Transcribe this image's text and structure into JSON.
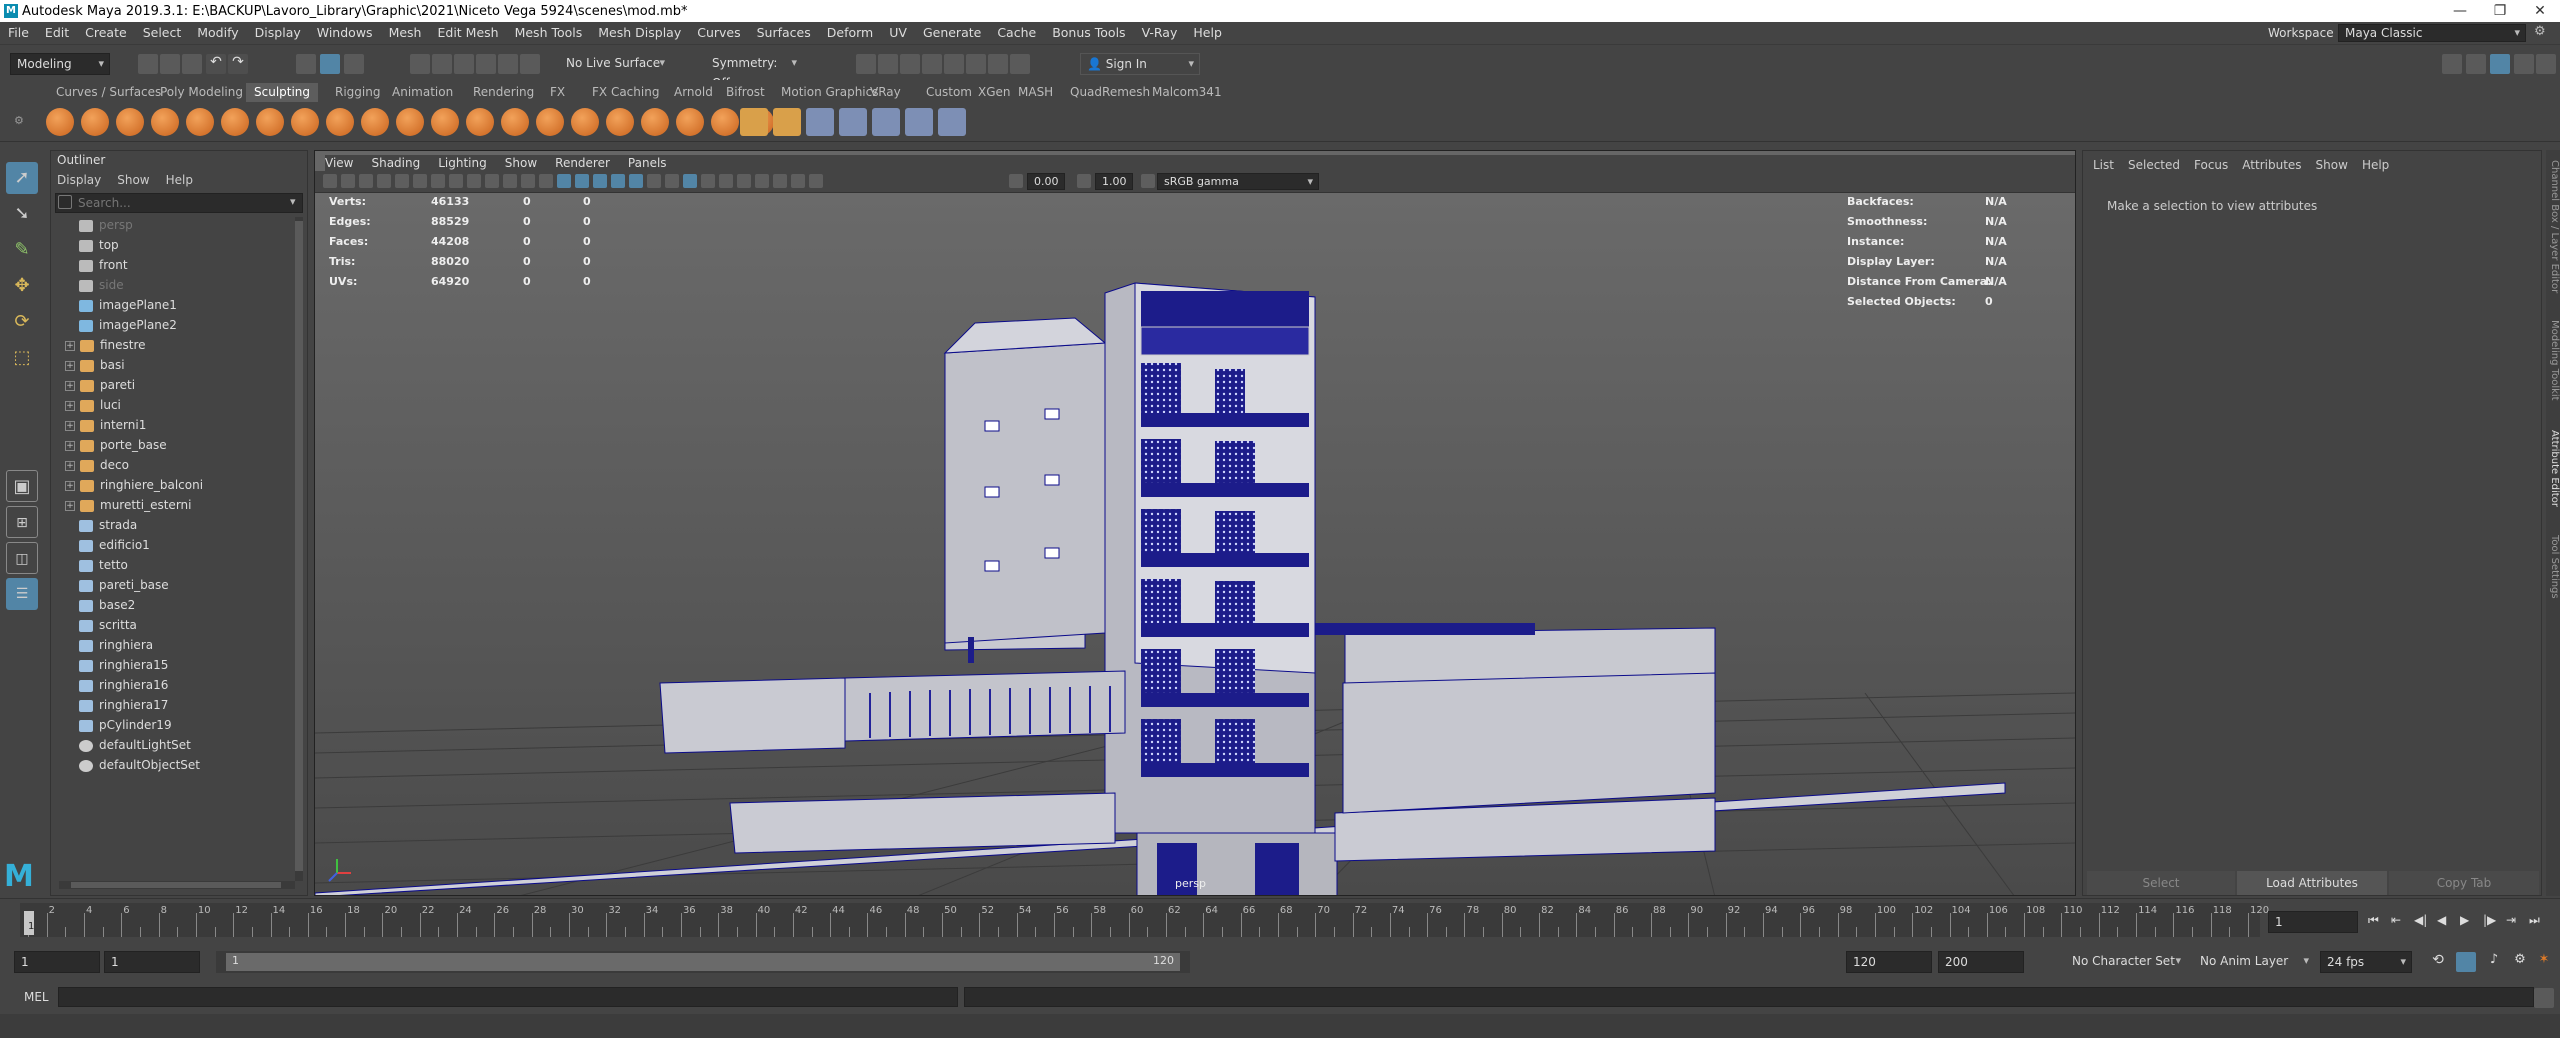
{
  "titlebar": {
    "title": "Autodesk Maya 2019.3.1: E:\\BACKUP\\Lavoro_Library\\Graphic\\2021\\Niceto Vega 5924\\scenes\\mod.mb*",
    "minimize": "—",
    "maximize": "❐",
    "close": "✕"
  },
  "menubar": {
    "items": [
      "File",
      "Edit",
      "Create",
      "Select",
      "Modify",
      "Display",
      "Windows",
      "Mesh",
      "Edit Mesh",
      "Mesh Tools",
      "Mesh Display",
      "Curves",
      "Surfaces",
      "Deform",
      "UV",
      "Generate",
      "Cache",
      "Bonus Tools",
      "V-Ray",
      "Help"
    ],
    "workspace_label": "Workspace :",
    "workspace_value": "Maya Classic"
  },
  "statusline": {
    "menuset": "Modeling",
    "live_surface": "No Live Surface",
    "symmetry": "Symmetry: Off",
    "sign_in": "Sign In"
  },
  "shelf": {
    "tabs": [
      "Curves / Surfaces",
      "Poly Modeling",
      "Sculpting",
      "Rigging",
      "Animation",
      "Rendering",
      "FX",
      "FX Caching",
      "Arnold",
      "Bifrost",
      "Motion Graphics",
      "VRay",
      "Custom",
      "XGen",
      "MASH",
      "QuadRemesh",
      "Malcom341"
    ],
    "active_tab": "Sculpting"
  },
  "outliner": {
    "title": "Outliner",
    "menu": [
      "Display",
      "Show",
      "Help"
    ],
    "search_placeholder": "Search...",
    "items": [
      {
        "label": "persp",
        "type": "camera",
        "dim": true,
        "expand": false
      },
      {
        "label": "top",
        "type": "camera",
        "dim": false,
        "expand": false
      },
      {
        "label": "front",
        "type": "camera",
        "dim": false,
        "expand": false
      },
      {
        "label": "side",
        "type": "camera",
        "dim": true,
        "expand": false
      },
      {
        "label": "imagePlane1",
        "type": "image",
        "dim": false,
        "expand": false
      },
      {
        "label": "imagePlane2",
        "type": "image",
        "dim": false,
        "expand": false
      },
      {
        "label": "finestre",
        "type": "group",
        "dim": false,
        "expand": true
      },
      {
        "label": "basi",
        "type": "group",
        "dim": false,
        "expand": true
      },
      {
        "label": "pareti",
        "type": "group",
        "dim": false,
        "expand": true
      },
      {
        "label": "luci",
        "type": "group",
        "dim": false,
        "expand": true
      },
      {
        "label": "interni1",
        "type": "group",
        "dim": false,
        "expand": true
      },
      {
        "label": "porte_base",
        "type": "group",
        "dim": false,
        "expand": true
      },
      {
        "label": "deco",
        "type": "group",
        "dim": false,
        "expand": true
      },
      {
        "label": "ringhiere_balconi",
        "type": "group",
        "dim": false,
        "expand": true
      },
      {
        "label": "muretti_esterni",
        "type": "group",
        "dim": false,
        "expand": true
      },
      {
        "label": "strada",
        "type": "mesh",
        "dim": false,
        "expand": false
      },
      {
        "label": "edificio1",
        "type": "mesh",
        "dim": false,
        "expand": false
      },
      {
        "label": "tetto",
        "type": "mesh",
        "dim": false,
        "expand": false
      },
      {
        "label": "pareti_base",
        "type": "mesh",
        "dim": false,
        "expand": false
      },
      {
        "label": "base2",
        "type": "mesh",
        "dim": false,
        "expand": false
      },
      {
        "label": "scritta",
        "type": "mesh",
        "dim": false,
        "expand": false
      },
      {
        "label": "ringhiera",
        "type": "mesh",
        "dim": false,
        "expand": false
      },
      {
        "label": "ringhiera15",
        "type": "mesh",
        "dim": false,
        "expand": false
      },
      {
        "label": "ringhiera16",
        "type": "mesh",
        "dim": false,
        "expand": false
      },
      {
        "label": "ringhiera17",
        "type": "mesh",
        "dim": false,
        "expand": false
      },
      {
        "label": "pCylinder19",
        "type": "mesh",
        "dim": false,
        "expand": false
      },
      {
        "label": "defaultLightSet",
        "type": "set",
        "dim": false,
        "expand": false
      },
      {
        "label": "defaultObjectSet",
        "type": "set",
        "dim": false,
        "expand": false
      }
    ]
  },
  "viewport": {
    "menu": [
      "View",
      "Shading",
      "Lighting",
      "Show",
      "Renderer",
      "Panels"
    ],
    "exposure": "0.00",
    "gamma": "1.00",
    "colorspace": "sRGB gamma",
    "camera_label": "persp",
    "stats": [
      {
        "label": "Verts:",
        "v1": "46133",
        "v2": "0",
        "v3": "0"
      },
      {
        "label": "Edges:",
        "v1": "88529",
        "v2": "0",
        "v3": "0"
      },
      {
        "label": "Faces:",
        "v1": "44208",
        "v2": "0",
        "v3": "0"
      },
      {
        "label": "Tris:",
        "v1": "88020",
        "v2": "0",
        "v3": "0"
      },
      {
        "label": "UVs:",
        "v1": "64920",
        "v2": "0",
        "v3": "0"
      }
    ],
    "info": [
      {
        "label": "Backfaces:",
        "value": "N/A"
      },
      {
        "label": "Smoothness:",
        "value": "N/A"
      },
      {
        "label": "Instance:",
        "value": "N/A"
      },
      {
        "label": "Display Layer:",
        "value": "N/A"
      },
      {
        "label": "Distance From Camera:",
        "value": "N/A"
      },
      {
        "label": "Selected Objects:",
        "value": "0"
      }
    ]
  },
  "attribute_editor": {
    "menu": [
      "List",
      "Selected",
      "Focus",
      "Attributes",
      "Show",
      "Help"
    ],
    "message": "Make a selection to view attributes",
    "select_btn": "Select",
    "load_btn": "Load Attributes",
    "copy_btn": "Copy Tab"
  },
  "side_tabs": [
    "Channel Box / Layer Editor",
    "Modeling Toolkit",
    "Attribute Editor",
    "Tool Settings"
  ],
  "timeslider": {
    "ticks": [
      "2",
      "4",
      "6",
      "8",
      "10",
      "12",
      "14",
      "16",
      "18",
      "20",
      "22",
      "24",
      "26",
      "28",
      "30",
      "32",
      "34",
      "36",
      "38",
      "40",
      "42",
      "44",
      "46",
      "48",
      "50",
      "52",
      "54",
      "56",
      "58",
      "60",
      "62",
      "64",
      "66",
      "68",
      "70",
      "72",
      "74",
      "76",
      "78",
      "80",
      "82",
      "84",
      "86",
      "88",
      "90",
      "92",
      "94",
      "96",
      "98",
      "100",
      "102",
      "104",
      "106",
      "108",
      "110",
      "112",
      "114",
      "116",
      "118",
      "120"
    ],
    "current_frame": "1",
    "start_marker": "1"
  },
  "rangeslider": {
    "start": "1",
    "playback_start": "1",
    "range_start": "1",
    "range_end": "120",
    "playback_end": "120",
    "end": "200",
    "character_set": "No Character Set",
    "anim_layer": "No Anim Layer",
    "fps": "24 fps"
  },
  "commandline": {
    "lang": "MEL"
  },
  "colors": {
    "ui_bg": "#444444",
    "viewport_bg": "#666666",
    "wire_blue": "#0b0b8a",
    "shelf_orange": "#e07b28",
    "active_tool": "#5285a6"
  }
}
